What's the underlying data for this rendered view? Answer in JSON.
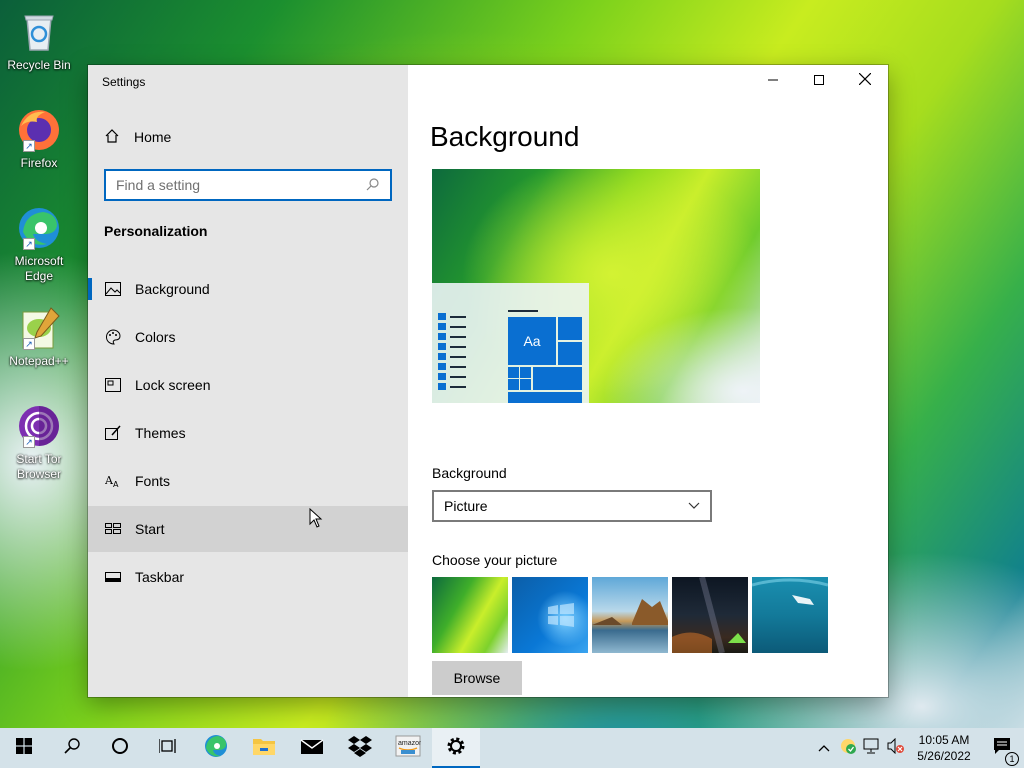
{
  "desktop": {
    "icons": [
      {
        "label": "Recycle Bin",
        "icon": "recycle-bin-icon"
      },
      {
        "label": "Firefox",
        "icon": "firefox-icon"
      },
      {
        "label": "Microsoft Edge",
        "icon": "edge-icon"
      },
      {
        "label": "Notepad++",
        "icon": "notepad-plus-plus-icon"
      },
      {
        "label": "Start Tor Browser",
        "icon": "tor-browser-icon"
      }
    ]
  },
  "window": {
    "title": "Settings",
    "controls": {
      "minimize": "minimize-icon",
      "maximize": "maximize-icon",
      "close": "close-icon"
    }
  },
  "sidebar": {
    "home_label": "Home",
    "search_placeholder": "Find a setting",
    "section_title": "Personalization",
    "items": [
      {
        "label": "Background",
        "icon": "picture-icon",
        "selected": true
      },
      {
        "label": "Colors",
        "icon": "palette-icon"
      },
      {
        "label": "Lock screen",
        "icon": "lock-screen-icon"
      },
      {
        "label": "Themes",
        "icon": "themes-brush-icon"
      },
      {
        "label": "Fonts",
        "icon": "fonts-icon"
      },
      {
        "label": "Start",
        "icon": "start-tiles-icon",
        "hovered": true
      },
      {
        "label": "Taskbar",
        "icon": "taskbar-icon"
      }
    ]
  },
  "main": {
    "title": "Background",
    "preview_tile_text": "Aa",
    "background_label": "Background",
    "background_value": "Picture",
    "choose_label": "Choose your picture",
    "browse_label": "Browse",
    "thumbnails": [
      "green-abstract",
      "windows-blue",
      "coastal-rocks",
      "night-sky-tent",
      "underwater-swimmer"
    ]
  },
  "taskbar": {
    "apps": [
      "start-icon",
      "search-icon",
      "cortana-icon",
      "task-view-icon",
      "edge-icon",
      "file-explorer-icon",
      "mail-icon",
      "dropbox-icon",
      "amazon-icon",
      "settings-gear-icon"
    ],
    "active": "settings-gear-icon",
    "time": "10:05 AM",
    "date": "5/26/2022",
    "notification_count": "1"
  },
  "colors": {
    "accent": "#0067c0",
    "sidebar_bg": "#e6e6e6",
    "taskbar_bg": "#d4e2e9"
  }
}
